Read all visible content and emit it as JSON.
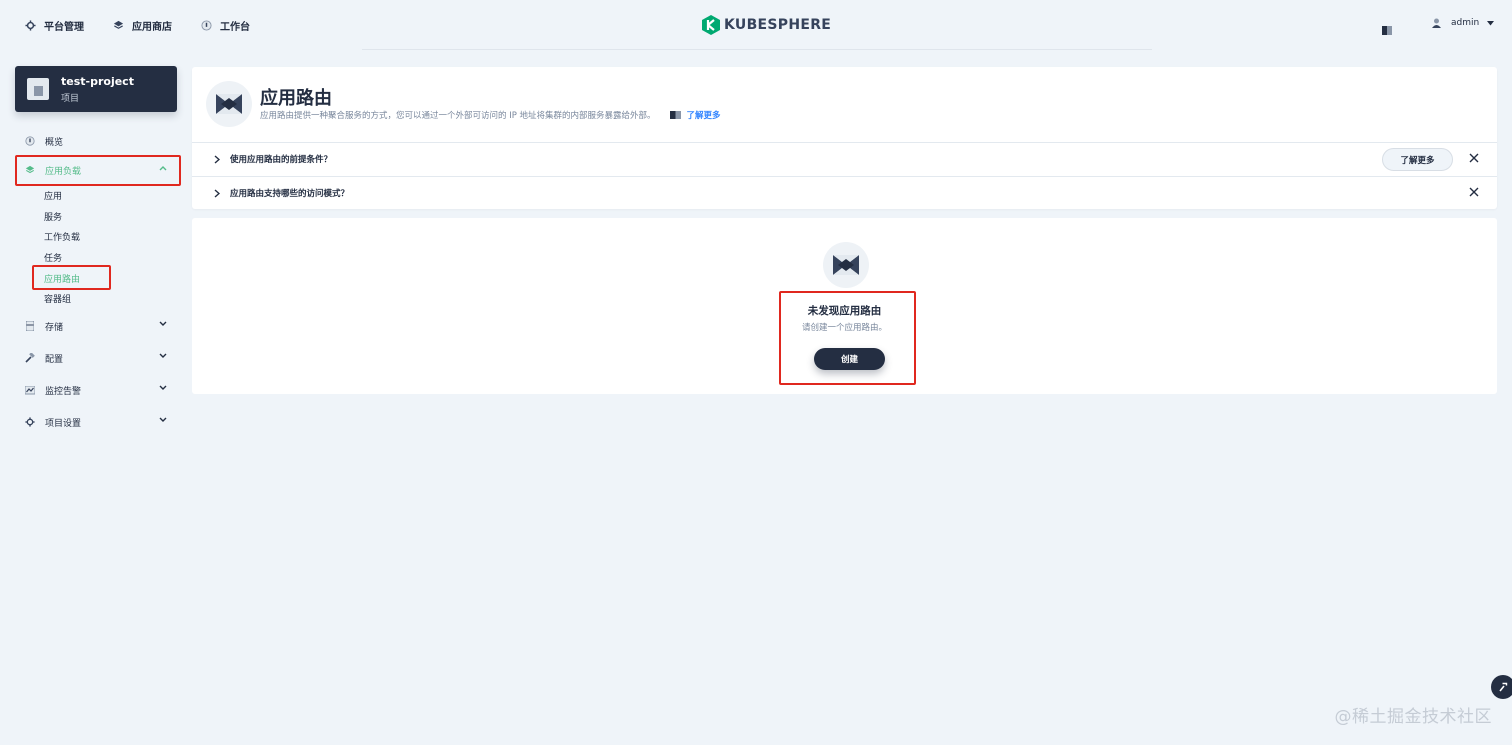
{
  "topnav": [
    {
      "label": "平台管理",
      "icon": "gear-icon"
    },
    {
      "label": "应用商店",
      "icon": "layers-icon"
    },
    {
      "label": "工作台",
      "icon": "dashboard-icon"
    }
  ],
  "brand": {
    "name": "KUBESPHERE",
    "color": "#00a971"
  },
  "user": {
    "name": "admin"
  },
  "project": {
    "name": "test-project",
    "type": "项目"
  },
  "sidebar": {
    "overview": "概览",
    "app_workloads": "应用负载",
    "sub_items": [
      "应用",
      "服务",
      "工作负载",
      "任务",
      "应用路由",
      "容器组"
    ],
    "storage": "存储",
    "config": "配置",
    "monitoring": "监控告警",
    "settings": "项目设置"
  },
  "banner": {
    "title": "应用路由",
    "description": "应用路由提供一种聚合服务的方式，您可以通过一个外部可访问的 IP 地址将集群的内部服务暴露给外部。",
    "learn_more": "了解更多",
    "faq": [
      {
        "question": "使用应用路由的前提条件？",
        "button": "了解更多"
      },
      {
        "question": "应用路由支持哪些的访问模式？"
      }
    ]
  },
  "empty": {
    "title": "未发现应用路由",
    "description": "请创建一个应用路由。",
    "create_label": "创建"
  },
  "watermark": "@稀土掘金技术社区",
  "colors": {
    "accent": "#55bc8a",
    "dark": "#242e42",
    "highlight": "#e0281f",
    "background": "#eff4f9"
  }
}
